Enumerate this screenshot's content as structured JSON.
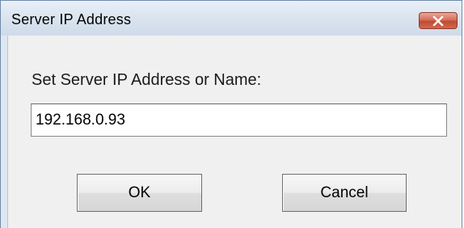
{
  "window": {
    "title": "Server IP Address",
    "close_icon": "close-icon"
  },
  "form": {
    "prompt": "Set Server IP Address or Name:",
    "server_value": "192.168.0.93"
  },
  "buttons": {
    "ok_label": "OK",
    "cancel_label": "Cancel"
  }
}
